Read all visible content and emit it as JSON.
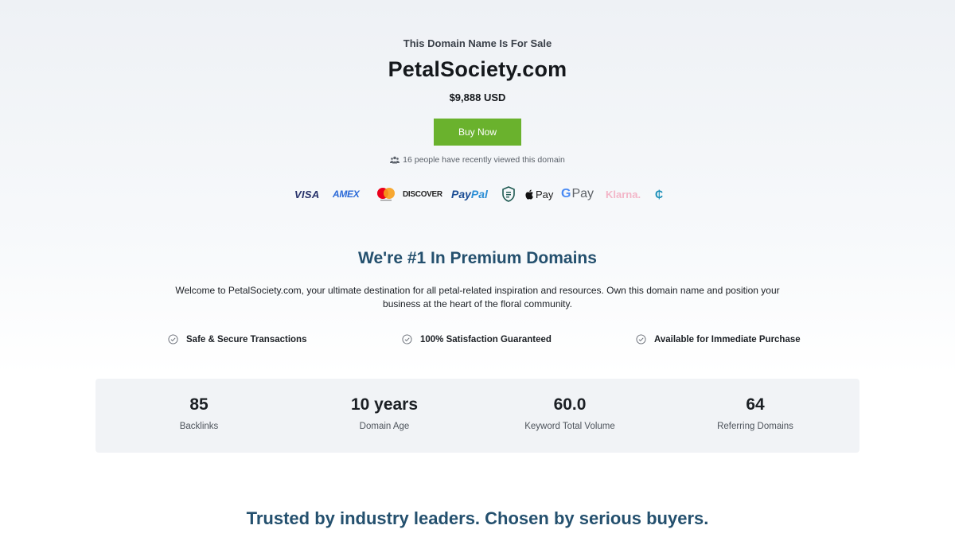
{
  "hero": {
    "eyebrow": "This Domain Name Is For Sale",
    "domain": "PetalSociety.com",
    "price": "$9,888 USD",
    "buy_label": "Buy Now",
    "viewers_text": "16 people have recently viewed this domain"
  },
  "payments": {
    "visa": "VISA",
    "amex": "AMEX",
    "discover": "DISCOVER",
    "paypal_a": "Pay",
    "paypal_b": "Pal",
    "applepay": "Pay",
    "gpay_g": "G",
    "gpay": "Pay",
    "klarna": "Klarna.",
    "coinbase": "₵"
  },
  "about": {
    "title": "We're #1 In Premium Domains",
    "description": "Welcome to PetalSociety.com, your ultimate destination for all petal-related inspiration and resources. Own this domain name and position your business at the heart of the floral community.",
    "features": [
      "Safe & Secure Transactions",
      "100% Satisfaction Guaranteed",
      "Available for Immediate Purchase"
    ]
  },
  "stats": [
    {
      "value": "85",
      "label": "Backlinks"
    },
    {
      "value": "10 years",
      "label": "Domain Age"
    },
    {
      "value": "60.0",
      "label": "Keyword Total Volume"
    },
    {
      "value": "64",
      "label": "Referring Domains"
    }
  ],
  "trusted": {
    "title": "Trusted by industry leaders. Chosen by serious buyers."
  },
  "colors": {
    "buy_button": "#6ab22d",
    "heading_blue": "#24506e",
    "stats_bg": "#f1f3f6"
  }
}
